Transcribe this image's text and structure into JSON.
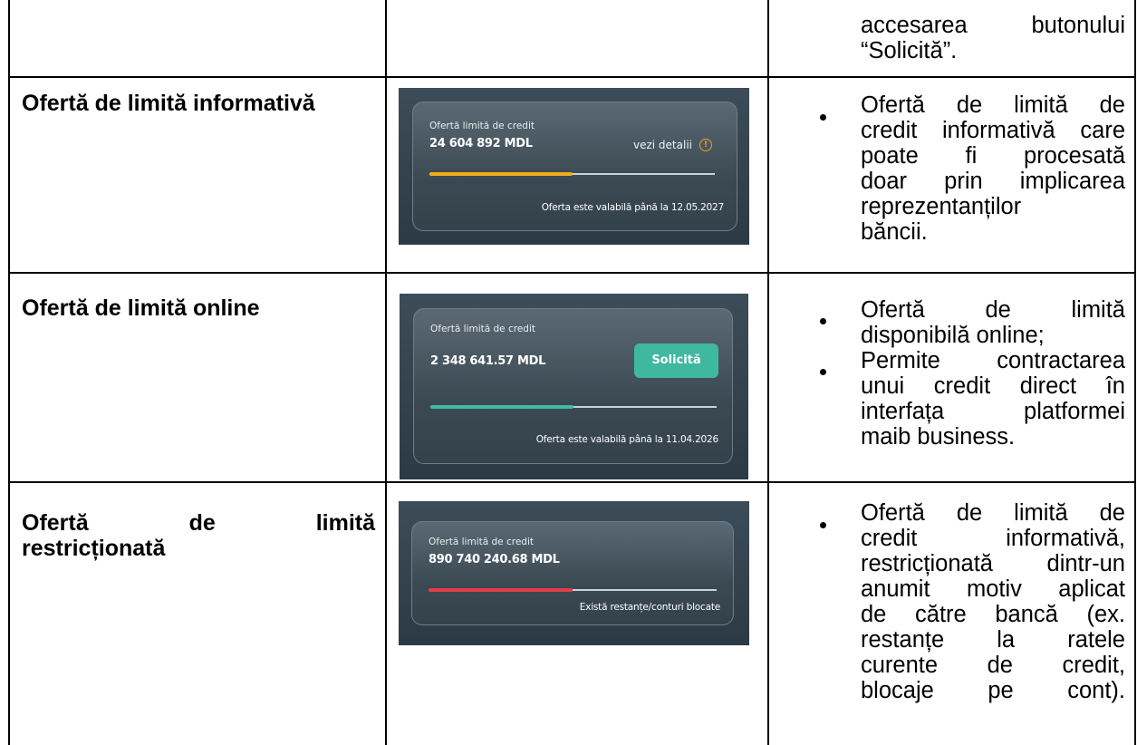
{
  "colors": {
    "progress_informative": "#f0ac1c",
    "progress_online": "#3fbba3",
    "progress_restricted": "#e23c4b",
    "button_green": "#3fb8a0",
    "card_background": "#2f3d48"
  },
  "top_row": {
    "desc_lines": [
      "accesarea butonului",
      "“Solicită”."
    ]
  },
  "rows": [
    {
      "label": "Ofertă de limită informativă",
      "card": {
        "title": "Ofertă limită de credit",
        "amount": "24 604 892 MDL",
        "link": "vezi detalii",
        "info_icon": "info-icon",
        "progress": 0.5,
        "footer": "Oferta este valabilă până la 12.05.2027"
      },
      "desc_lines": [
        "Ofertă de limită de",
        "credit informativă care",
        "poate fi procesată",
        "doar prin implicarea",
        "reprezentanților",
        "băncii."
      ]
    },
    {
      "label": "Ofertă de limită online",
      "card": {
        "title": "Ofertă limită de credit",
        "amount": "2 348 641.57 MDL",
        "button": "Solicită",
        "progress": 0.5,
        "footer": "Oferta este valabilă până la 11.04.2026"
      },
      "bullets": [
        [
          "Ofertă de limită",
          "disponibilă online;"
        ],
        [
          "Permite contractarea",
          "unui credit direct în",
          "interfața platformei",
          "maib business."
        ]
      ]
    },
    {
      "label_line1": "Ofertă de limită",
      "label_line2": "restricționată",
      "card": {
        "title": "Ofertă limită de credit",
        "amount": "890 740 240.68 MDL",
        "progress": 0.5,
        "footer": "Există restanțe/conturi blocate"
      },
      "desc_lines": [
        "Ofertă de limită de",
        "credit informativă,",
        "restricționată dintr-un",
        "anumit motiv aplicat",
        "de către bancă (ex.",
        "restanțe la ratele",
        "curente de credit,",
        "blocaje pe cont)."
      ]
    }
  ]
}
